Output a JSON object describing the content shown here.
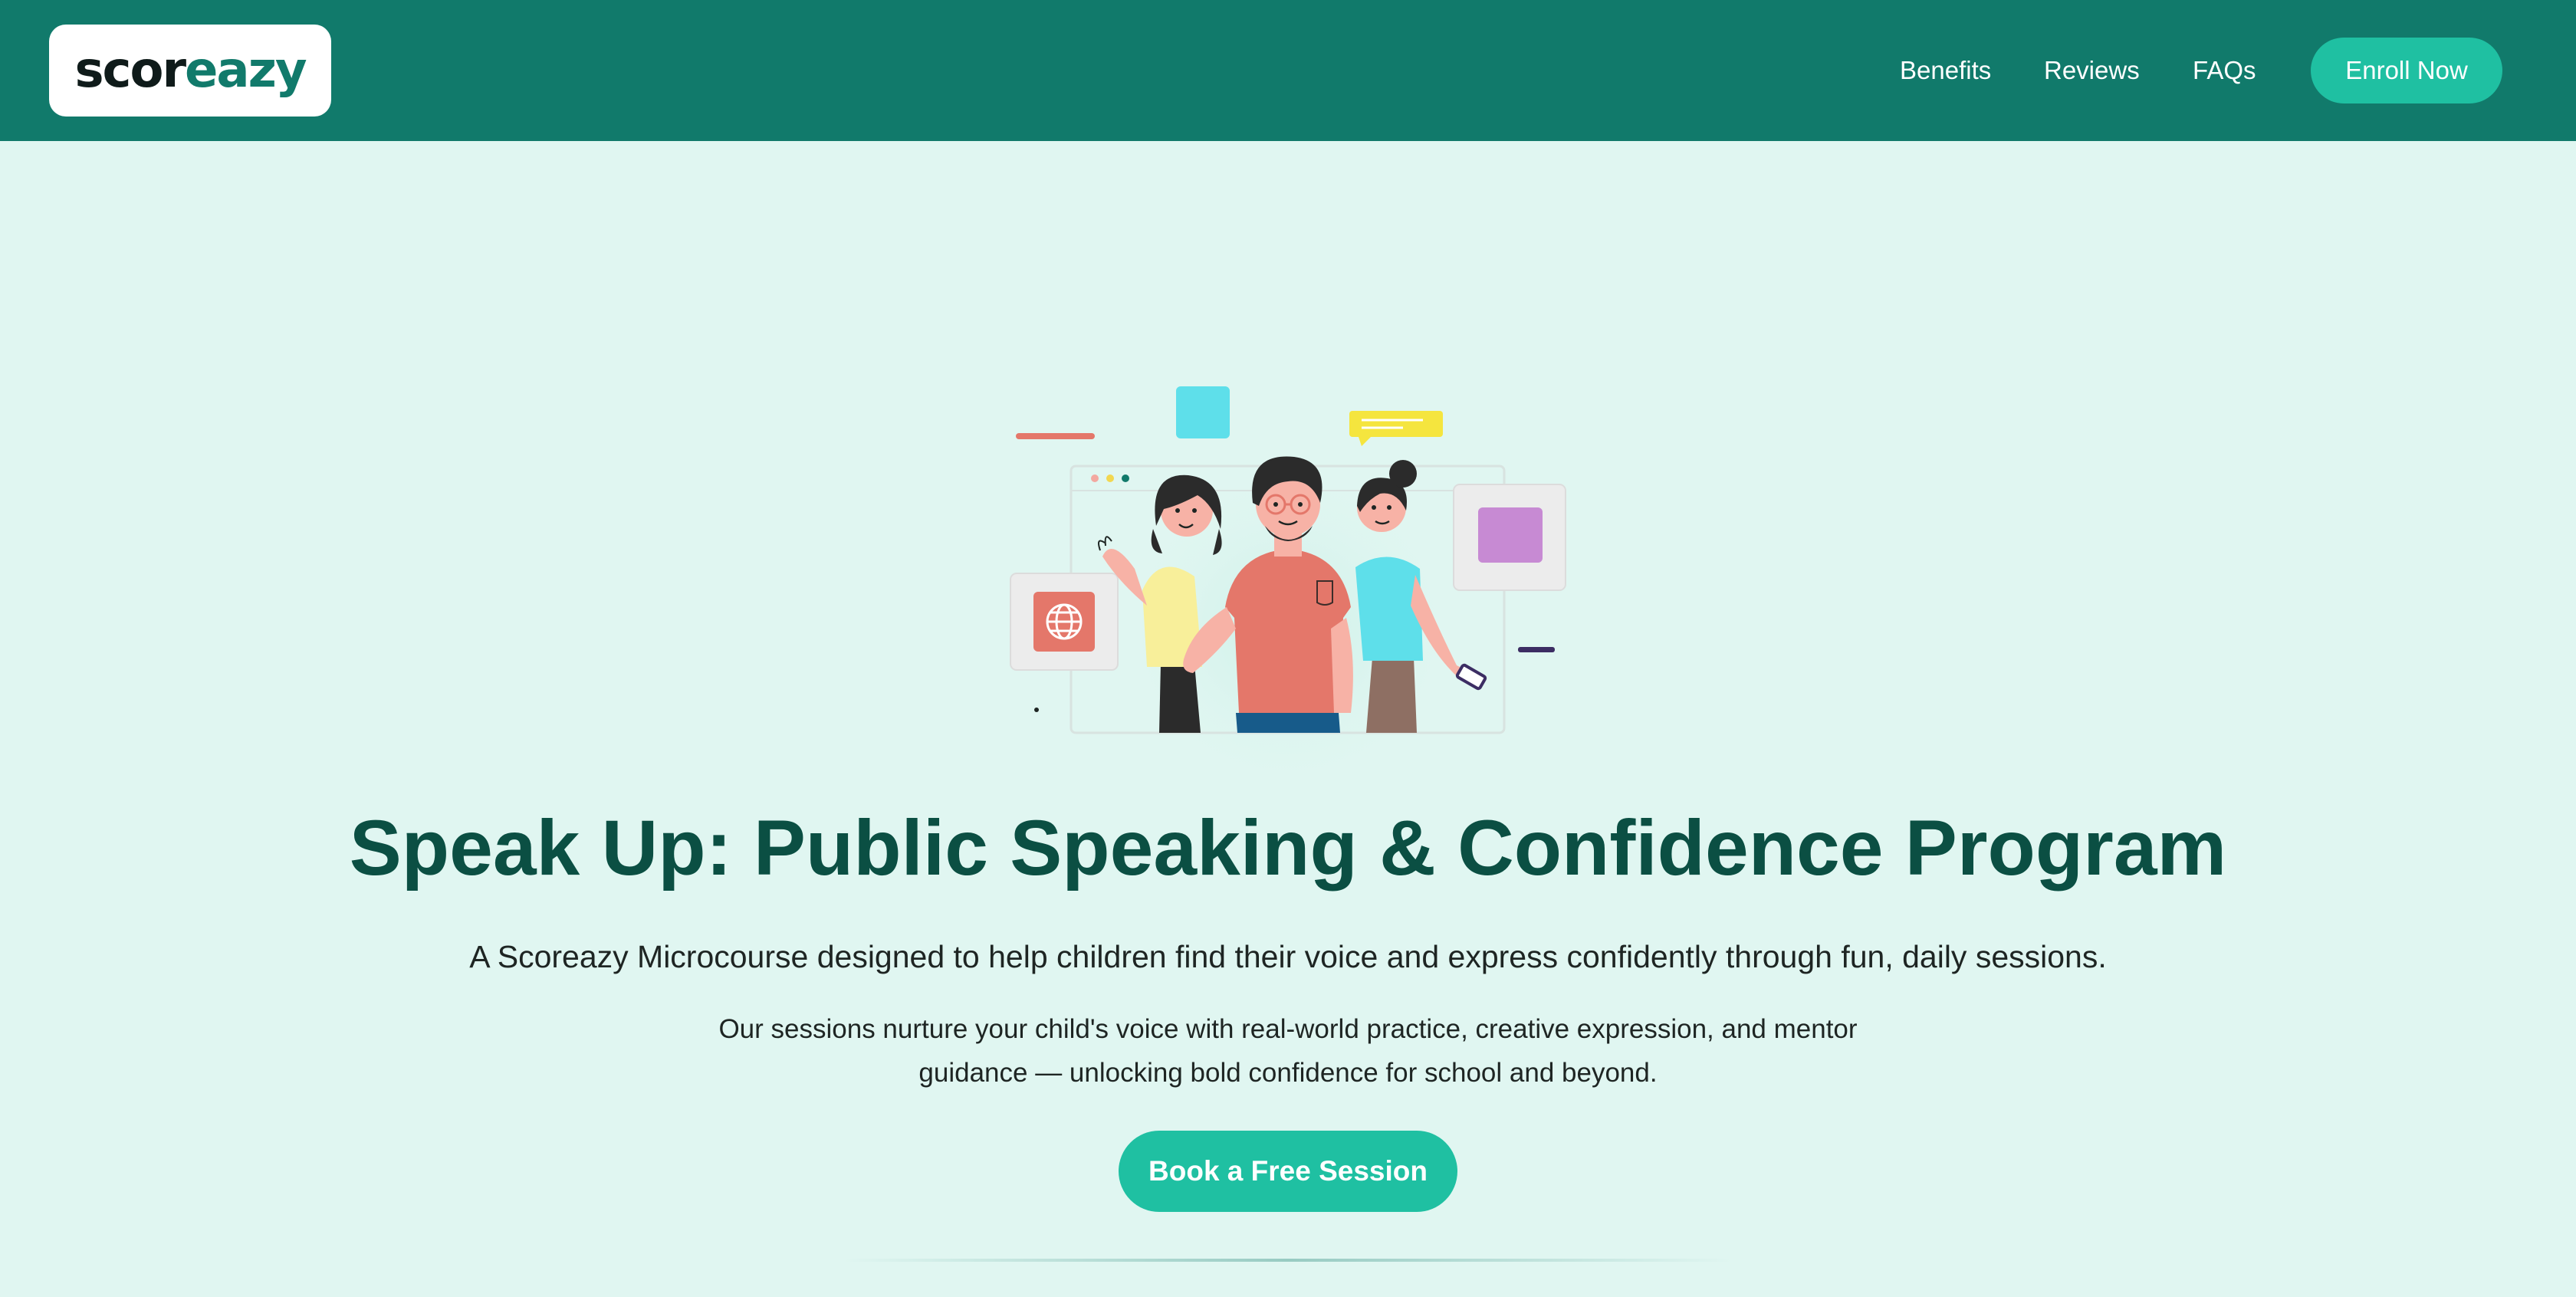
{
  "header": {
    "logo": {
      "part1": "scor",
      "part2": "eazy"
    },
    "nav": [
      {
        "label": "Benefits"
      },
      {
        "label": "Reviews"
      },
      {
        "label": "FAQs"
      }
    ],
    "enroll_label": "Enroll Now"
  },
  "hero": {
    "illustration_icon": "people-group-illustration",
    "title": "Speak Up: Public Speaking & Confidence Program",
    "subtitle": "A Scoreazy Microcourse designed to help children find their voice and express confidently through fun, daily sessions.",
    "description": "Our sessions nurture your child's voice with real-world practice, creative expression, and mentor guidance — unlocking bold confidence for school and beyond.",
    "cta_label": "Book a Free Session"
  },
  "colors": {
    "header_bg": "#117a6b",
    "page_bg": "#e0f6f1",
    "accent": "#1fc0a2",
    "title": "#0b4f43"
  }
}
